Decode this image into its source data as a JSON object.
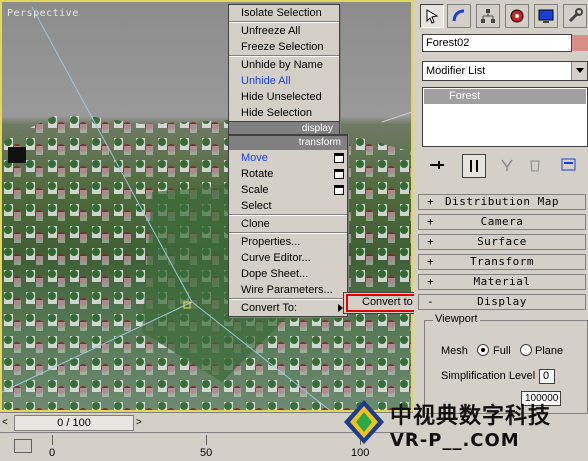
{
  "viewport": {
    "label": "Perspective"
  },
  "quad_menu": {
    "display_items": [
      "Isolate Selection",
      "Unfreeze All",
      "Freeze Selection",
      "Unhide by Name",
      "Unhide All",
      "Hide Unselected",
      "Hide Selection"
    ],
    "display_header": "display",
    "transform_header": "transform",
    "transform_items": [
      "Move",
      "Rotate",
      "Scale",
      "Select",
      "Clone",
      "Properties...",
      "Curve Editor...",
      "Dope Sheet...",
      "Wire Parameters...",
      "Convert To:"
    ]
  },
  "submenu": {
    "item": "Convert to Editable Mesh"
  },
  "panel": {
    "object_name": "Forest02",
    "object_color": "#d88f88",
    "modifier_list": "Modifier List",
    "stack_item": "Forest",
    "rollouts": [
      "Distribution Map",
      "Camera",
      "Surface",
      "Transform",
      "Material",
      "Display"
    ],
    "viewport_group": {
      "title": "Viewport",
      "mesh_label": "Mesh",
      "option_full": "Full",
      "option_plane": "Plane",
      "simplification_label": "Simplification Level",
      "simplification_value": "0",
      "limit_value": "100000"
    }
  },
  "timeline": {
    "slider_text": "0 / 100",
    "ticks": [
      "0",
      "50",
      "100"
    ]
  },
  "watermark": {
    "cn": "中视典数字科技",
    "url": "VR-P__.COM"
  }
}
